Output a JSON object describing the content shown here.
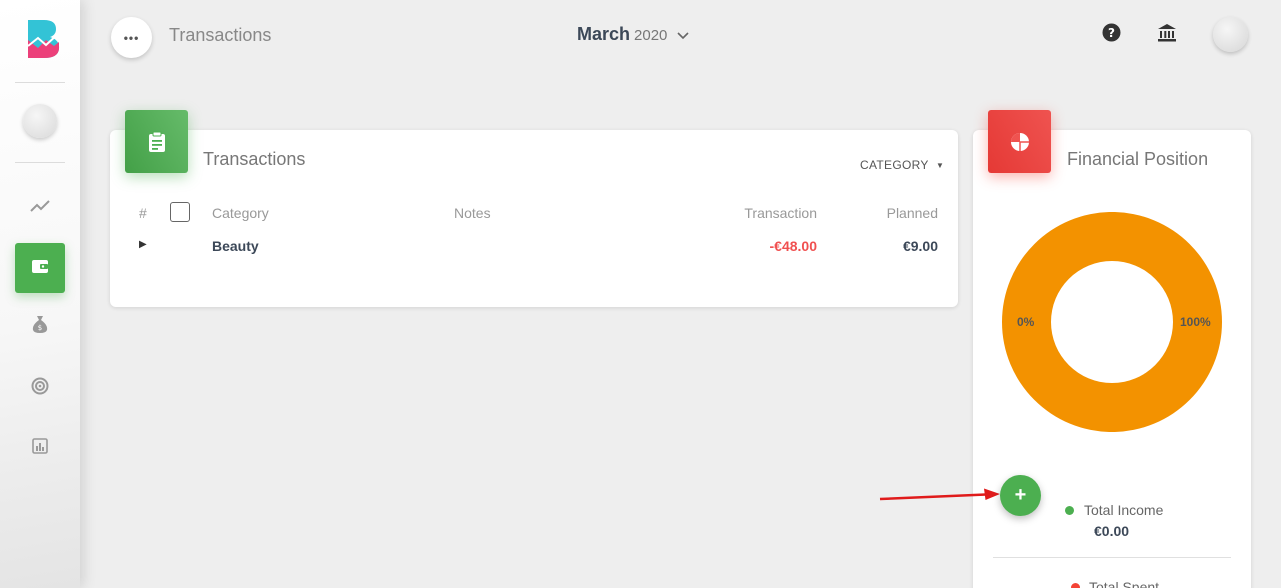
{
  "header": {
    "page_title": "Transactions",
    "month": "March",
    "year": "2020"
  },
  "sidebar": {
    "items": [
      {
        "icon": "trending-icon",
        "active": false
      },
      {
        "icon": "wallet-icon",
        "active": true
      },
      {
        "icon": "money-bag-icon",
        "active": false
      },
      {
        "icon": "target-icon",
        "active": false
      },
      {
        "icon": "bar-chart-icon",
        "active": false
      }
    ]
  },
  "transactions_card": {
    "title": "Transactions",
    "group_by": "CATEGORY",
    "columns": [
      "#",
      "Category",
      "Notes",
      "Transaction",
      "Planned"
    ],
    "rows": [
      {
        "category": "Beauty",
        "notes": "",
        "transaction": "-€48.00",
        "planned": "€9.00"
      }
    ]
  },
  "financial_card": {
    "title": "Financial Position",
    "donut_left_label": "0%",
    "donut_right_label": "100%",
    "legend": [
      {
        "label": "Total Income",
        "value": "€0.00",
        "color": "#4caf50"
      },
      {
        "label": "Total Spent",
        "color": "#f44336"
      }
    ]
  },
  "chart_data": {
    "type": "pie",
    "categories": [
      "Total Income",
      "Total Spent"
    ],
    "values": [
      0,
      100
    ]
  },
  "colors": {
    "accent": "#4caf50",
    "danger": "#f44336",
    "donut": "#f39200",
    "negative_text": "#f05050"
  }
}
